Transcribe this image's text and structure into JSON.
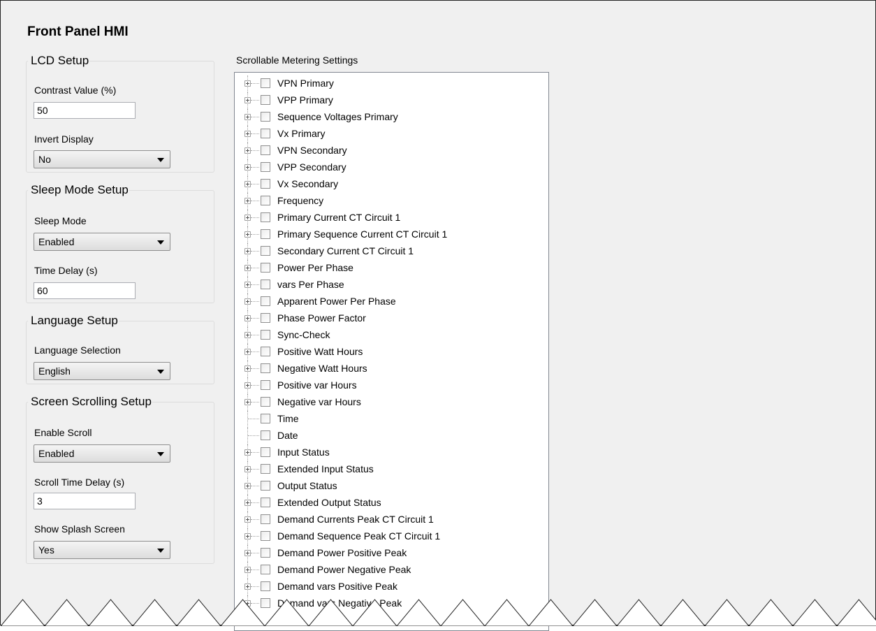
{
  "page": {
    "title": "Front Panel HMI"
  },
  "lcd_setup": {
    "legend": "LCD Setup",
    "contrast_label": "Contrast Value (%)",
    "contrast_value": "50",
    "invert_label": "Invert Display",
    "invert_value": "No"
  },
  "sleep_setup": {
    "legend": "Sleep Mode Setup",
    "mode_label": "Sleep Mode",
    "mode_value": "Enabled",
    "delay_label": "Time Delay (s)",
    "delay_value": "60"
  },
  "language_setup": {
    "legend": "Language Setup",
    "selection_label": "Language Selection",
    "selection_value": "English"
  },
  "scroll_setup": {
    "legend": "Screen Scrolling Setup",
    "enable_label": "Enable Scroll",
    "enable_value": "Enabled",
    "delay_label": "Scroll Time Delay (s)",
    "delay_value": "3",
    "splash_label": "Show Splash Screen",
    "splash_value": "Yes"
  },
  "metering": {
    "title": "Scrollable Metering Settings",
    "items": [
      {
        "label": "VPN Primary",
        "expandable": true
      },
      {
        "label": "VPP Primary",
        "expandable": true
      },
      {
        "label": "Sequence Voltages Primary",
        "expandable": true
      },
      {
        "label": "Vx Primary",
        "expandable": true
      },
      {
        "label": "VPN Secondary",
        "expandable": true
      },
      {
        "label": "VPP Secondary",
        "expandable": true
      },
      {
        "label": "Vx Secondary",
        "expandable": true
      },
      {
        "label": "Frequency",
        "expandable": true
      },
      {
        "label": "Primary Current CT Circuit 1",
        "expandable": true
      },
      {
        "label": "Primary Sequence Current CT Circuit 1",
        "expandable": true
      },
      {
        "label": "Secondary Current CT Circuit 1",
        "expandable": true
      },
      {
        "label": "Power Per Phase",
        "expandable": true
      },
      {
        "label": "vars Per Phase",
        "expandable": true
      },
      {
        "label": "Apparent Power Per Phase",
        "expandable": true
      },
      {
        "label": "Phase Power Factor",
        "expandable": true
      },
      {
        "label": "Sync-Check",
        "expandable": true
      },
      {
        "label": "Positive Watt Hours",
        "expandable": true
      },
      {
        "label": "Negative Watt Hours",
        "expandable": true
      },
      {
        "label": "Positive var Hours",
        "expandable": true
      },
      {
        "label": "Negative var Hours",
        "expandable": true
      },
      {
        "label": "Time",
        "expandable": false
      },
      {
        "label": "Date",
        "expandable": false
      },
      {
        "label": "Input Status",
        "expandable": true
      },
      {
        "label": "Extended Input Status",
        "expandable": true
      },
      {
        "label": "Output Status",
        "expandable": true
      },
      {
        "label": "Extended Output Status",
        "expandable": true
      },
      {
        "label": "Demand Currents Peak CT Circuit 1",
        "expandable": true
      },
      {
        "label": "Demand Sequence Peak CT Circuit 1",
        "expandable": true
      },
      {
        "label": "Demand Power Positive  Peak",
        "expandable": true
      },
      {
        "label": "Demand Power Negative Peak",
        "expandable": true
      },
      {
        "label": "Demand vars Positive Peak",
        "expandable": true
      },
      {
        "label": "Demand vars Negative Peak",
        "expandable": true
      }
    ]
  }
}
